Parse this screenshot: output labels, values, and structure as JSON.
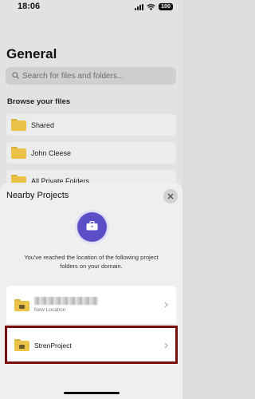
{
  "status_bar": {
    "time": "18:06",
    "battery": "100"
  },
  "page": {
    "title": "General",
    "search": {
      "placeholder": "Search for files and folders..."
    },
    "section_label": "Browse your files",
    "folders": [
      {
        "label": "Shared",
        "icon": "folder-icon"
      },
      {
        "label": "John Cleese",
        "icon": "folder-icon"
      },
      {
        "label": "All Private Folders",
        "icon": "folder-icon"
      }
    ]
  },
  "sheet": {
    "title": "Nearby Projects",
    "message": "You've reached the location of the following project folders on your domain.",
    "locations": [
      {
        "name": "",
        "subtitle": "New Location",
        "icon": "briefcase-folder-icon"
      },
      {
        "name": "StrenProject",
        "subtitle": "",
        "icon": "briefcase-folder-icon"
      }
    ]
  },
  "colors": {
    "accent": "#5b4fc8",
    "folder": "#e9c247",
    "highlight": "#7a0d0d"
  }
}
